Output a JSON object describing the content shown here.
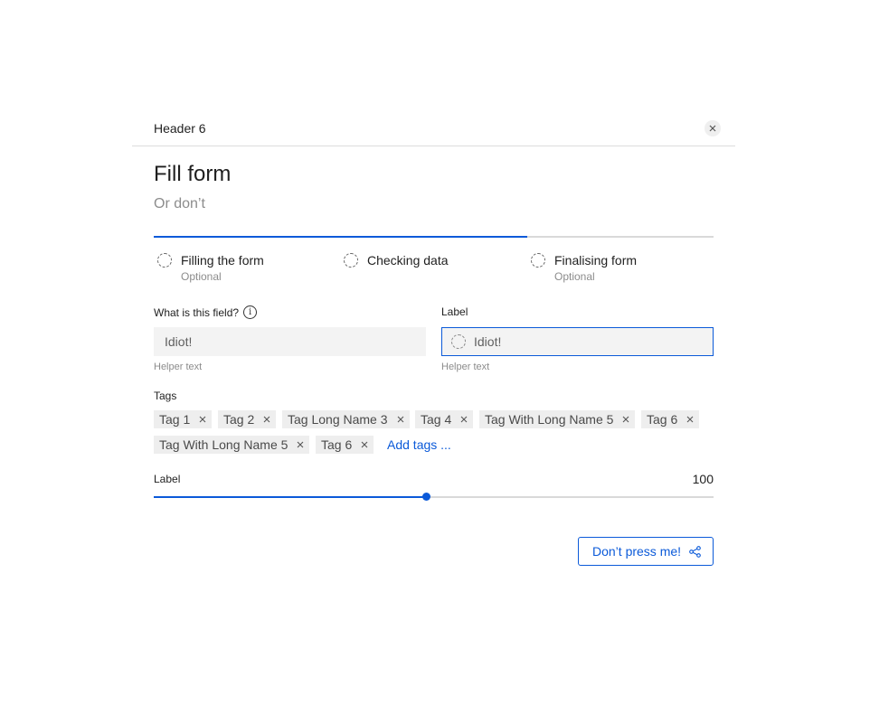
{
  "header": {
    "title": "Header 6"
  },
  "form": {
    "title": "Fill form",
    "subtitle": "Or don’t"
  },
  "progress": {
    "fraction": 0.667
  },
  "steps": [
    {
      "label": "Filling the form",
      "sub": "Optional"
    },
    {
      "label": "Checking data",
      "sub": ""
    },
    {
      "label": "Finalising form",
      "sub": "Optional"
    }
  ],
  "fields": [
    {
      "label": "What is this field?",
      "value": "Idiot!",
      "helper": "Helper text"
    },
    {
      "label": "Label",
      "value": "Idiot!",
      "helper": "Helper text"
    }
  ],
  "tags": {
    "label": "Tags",
    "items": [
      "Tag 1",
      "Tag 2",
      "Tag Long Name 3",
      "Tag 4",
      "Tag With Long Name 5",
      "Tag 6",
      "Tag With Long Name 5",
      "Tag 6"
    ],
    "add_label": "Add tags ..."
  },
  "slider": {
    "label": "Label",
    "value": "100",
    "fraction": 0.486
  },
  "action": {
    "label": "Don’t press me!"
  },
  "colors": {
    "accent": "#0b5ad9",
    "input_bg": "#f3f3f3",
    "muted": "#8c8c8c"
  },
  "icons": {
    "close": "close-icon",
    "info": "info-icon",
    "share": "share-icon"
  }
}
